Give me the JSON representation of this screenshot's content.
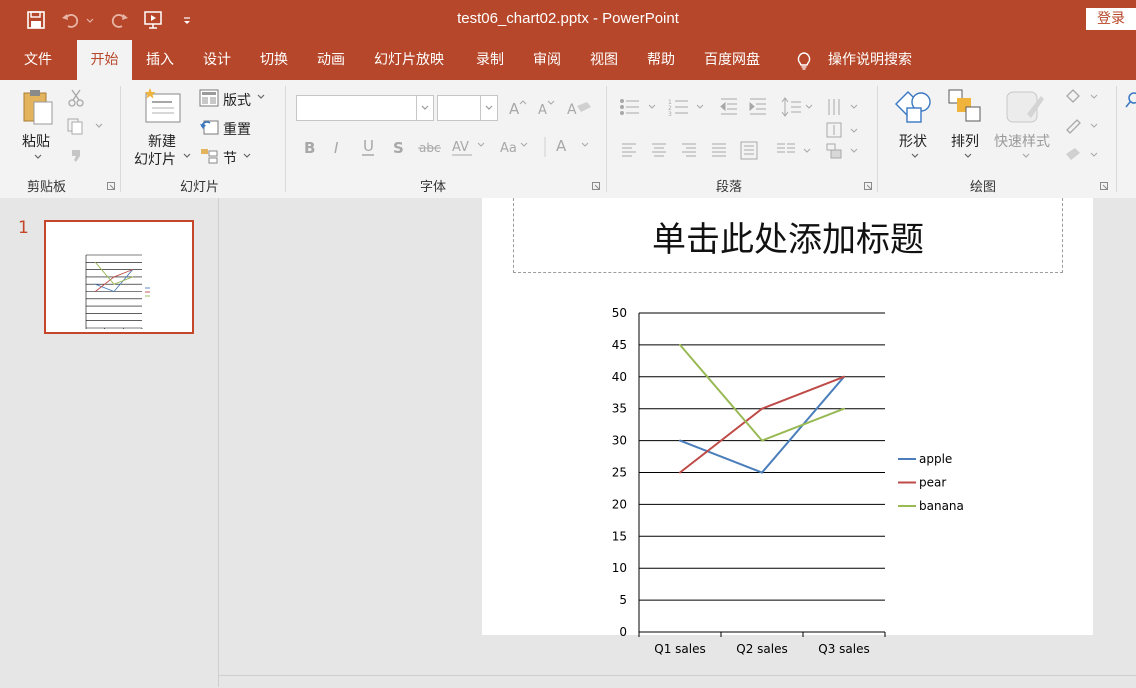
{
  "window": {
    "title": "test06_chart02.pptx  -  PowerPoint",
    "login_label": "登录"
  },
  "menu": {
    "tabs": [
      "文件",
      "开始",
      "插入",
      "设计",
      "切换",
      "动画",
      "幻灯片放映",
      "录制",
      "审阅",
      "视图",
      "帮助",
      "百度网盘"
    ],
    "active_tab": "开始",
    "search_label": "操作说明搜索"
  },
  "ribbon": {
    "clipboard": {
      "label": "剪贴板",
      "paste": "粘贴"
    },
    "slides": {
      "label": "幻灯片",
      "new_slide_line1": "新建",
      "new_slide_line2": "幻灯片",
      "layout": "版式",
      "reset": "重置",
      "section": "节"
    },
    "font": {
      "label": "字体",
      "font_name": "",
      "font_size": ""
    },
    "paragraph": {
      "label": "段落"
    },
    "drawing": {
      "label": "绘图",
      "shapes": "形状",
      "arrange": "排列",
      "quick_styles": "快速样式"
    }
  },
  "thumbnails": {
    "slide_number": "1"
  },
  "slide": {
    "title_placeholder": "单击此处添加标题"
  },
  "chart_data": {
    "type": "line",
    "categories": [
      "Q1 sales",
      "Q2 sales",
      "Q3 sales"
    ],
    "series": [
      {
        "name": "apple",
        "values": [
          30,
          25,
          40
        ],
        "color": "#4a7ebb"
      },
      {
        "name": "pear",
        "values": [
          25,
          35,
          40
        ],
        "color": "#be4b48"
      },
      {
        "name": "banana",
        "values": [
          45,
          30,
          35
        ],
        "color": "#98b954"
      }
    ],
    "ylim": [
      0,
      50
    ],
    "yticks": [
      0,
      5,
      10,
      15,
      20,
      25,
      30,
      35,
      40,
      45,
      50
    ],
    "grid": true,
    "legend": "right"
  },
  "colors": {
    "accent": "#b7472a"
  }
}
